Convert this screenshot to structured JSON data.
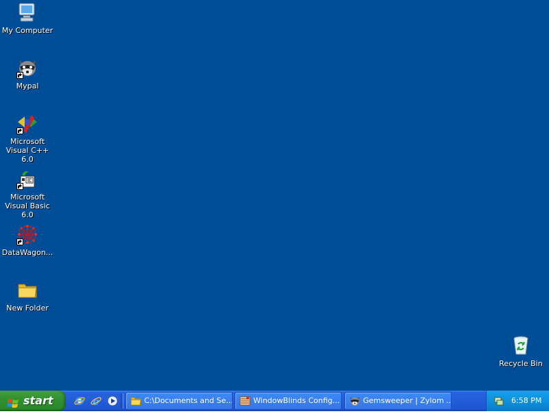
{
  "desktop": {
    "background": "#004e98",
    "icons": [
      {
        "label": "My Computer",
        "icon": "computer-icon"
      },
      {
        "label": "Mypal",
        "icon": "raccoon-icon",
        "shortcut": true
      },
      {
        "label": "Microsoft Visual C++ 6.0",
        "icon": "visual-cpp-icon",
        "shortcut": true
      },
      {
        "label": "Microsoft Visual Basic 6.0",
        "icon": "visual-basic-icon",
        "shortcut": true
      },
      {
        "label": "DataWagon...",
        "icon": "datawagon-icon",
        "shortcut": true
      },
      {
        "label": "New Folder",
        "icon": "folder-icon"
      },
      {
        "label": "Recycle Bin",
        "icon": "recycle-bin-icon"
      }
    ]
  },
  "taskbar": {
    "start_label": "start",
    "quick_launch": [
      "internet-explorer-icon",
      "internet-explorer-alt-icon",
      "media-player-icon"
    ],
    "tasks": [
      {
        "label": "C:\\Documents and Se...",
        "icon": "folder-icon"
      },
      {
        "label": "WindowBlinds Config...",
        "icon": "windowblinds-icon"
      },
      {
        "label": "Gemsweeper | Zylom ...",
        "icon": "raccoon-icon"
      }
    ],
    "tray": {
      "icon": "network-icon",
      "clock": "6:58 PM"
    }
  }
}
